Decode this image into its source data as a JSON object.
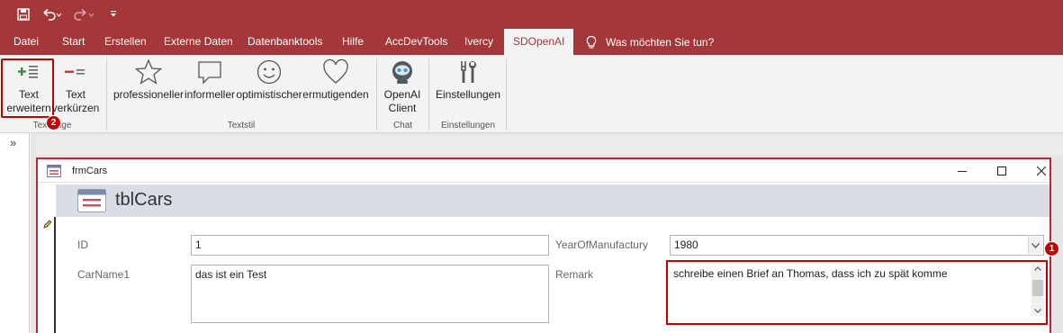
{
  "tabs": [
    "Datei",
    "Start",
    "Erstellen",
    "Externe Daten",
    "Datenbanktools",
    "Hilfe",
    "AccDevTools",
    "Ivercy",
    "SDOpenAI"
  ],
  "tell_me": "Was möchten Sie tun?",
  "ribbon": {
    "text_erweitern": [
      "Text",
      "erweitern"
    ],
    "text_verkuerzen": [
      "Text",
      "verkürzen"
    ],
    "group_textlaenge": "Textlänge",
    "professioneller": "professioneller",
    "informeller": "informeller",
    "optimistischer": "optimistischer",
    "ermutigenden": "ermutigenden",
    "group_textstil": "Textstil",
    "openai_client": [
      "OpenAI",
      "Client"
    ],
    "group_chat": "Chat",
    "einstellungen": "Einstellungen",
    "group_einstellungen": "Einstellungen"
  },
  "markers": {
    "step1": "1",
    "step2": "2"
  },
  "nav_toggle": "»",
  "form": {
    "window_caption": "frmCars",
    "header_title": "tblCars",
    "id_label": "ID",
    "id_value": "1",
    "carname_label": "CarName1",
    "carname_value": "das ist ein Test",
    "year_label": "YearOfManufactury",
    "year_value": "1980",
    "remark_label": "Remark",
    "remark_value": "schreibe einen Brief an Thomas, dass ich zu spät komme"
  },
  "colors": {
    "accent": "#a4373a",
    "highlight": "#c00000"
  }
}
